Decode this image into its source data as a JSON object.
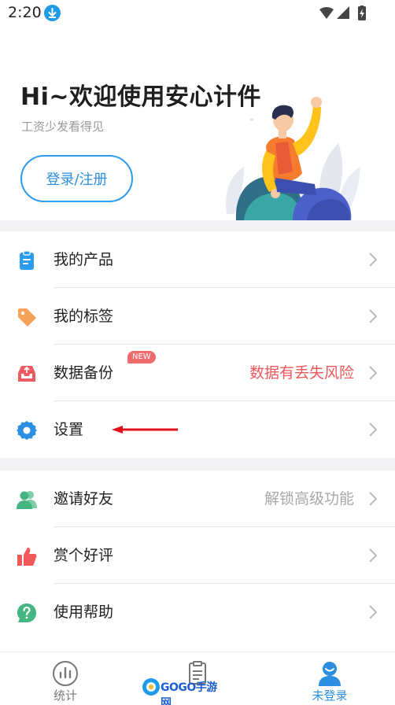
{
  "status_bar": {
    "time": "2:20"
  },
  "header": {
    "title": "Hi~欢迎使用安心计件",
    "subtitle": "工资少发看得见",
    "login_label": "登录/注册"
  },
  "menu_group_1": [
    {
      "label": "我的产品",
      "hint": "",
      "icon": "clipboard-icon",
      "color": "#2d9cee"
    },
    {
      "label": "我的标签",
      "hint": "",
      "icon": "tag-icon",
      "color": "#f7a25a"
    },
    {
      "label": "数据备份",
      "hint": "数据有丢失风险",
      "badge": "NEW",
      "icon": "backup-tray-icon",
      "color": "#ee5b62"
    },
    {
      "label": "设置",
      "hint": "",
      "icon": "gear-icon",
      "color": "#2d8fe0"
    }
  ],
  "menu_group_2": [
    {
      "label": "邀请好友",
      "hint": "解锁高级功能",
      "icon": "users-icon",
      "color": "#45b582"
    },
    {
      "label": "赏个好评",
      "hint": "",
      "icon": "thumbs-up-icon",
      "color": "#f0575b"
    },
    {
      "label": "使用帮助",
      "hint": "",
      "icon": "help-bubble-icon",
      "color": "#45b582"
    }
  ],
  "bottom_nav": {
    "tabs": [
      {
        "label": "统计",
        "icon": "chart-icon"
      },
      {
        "label": "记件",
        "icon": "clipboard-icon"
      },
      {
        "label": "未登录",
        "icon": "user-icon"
      }
    ],
    "active": 2
  },
  "watermark": {
    "text": "GOGO手游网"
  },
  "colors": {
    "accent": "#2d8fe0",
    "warning": "#f0575b",
    "background_gap": "#f4f4f6"
  }
}
